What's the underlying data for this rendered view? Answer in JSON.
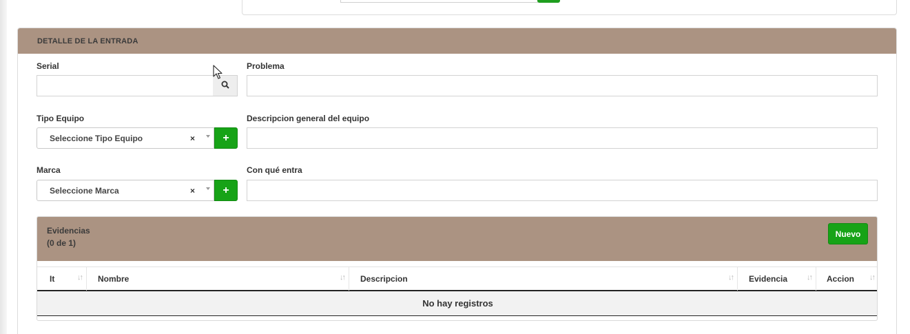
{
  "section": {
    "title": "DETALLE DE LA ENTRADA"
  },
  "fields": {
    "serial_label": "Serial",
    "serial_value": "",
    "problema_label": "Problema",
    "problema_value": "",
    "tipo_equipo_label": "Tipo Equipo",
    "tipo_equipo_selected": "Seleccione Tipo Equipo",
    "descripcion_label": "Descripcion general del equipo",
    "descripcion_value": "",
    "marca_label": "Marca",
    "marca_selected": "Seleccione Marca",
    "con_que_label": "Con qué entra",
    "con_que_value": ""
  },
  "icons": {
    "search": "search-icon",
    "clear": "×",
    "add": "+"
  },
  "evidencias": {
    "title": "Evidencias",
    "count": "(0 de 1)",
    "new_button": "Nuevo",
    "columns": [
      "It",
      "Nombre",
      "Descripcion",
      "Evidencia",
      "Accion"
    ],
    "sort_glyph": "↓↑",
    "empty_message": "No hay registros"
  },
  "colors": {
    "header_bg": "#ab9382",
    "primary_green": "#17a317"
  }
}
